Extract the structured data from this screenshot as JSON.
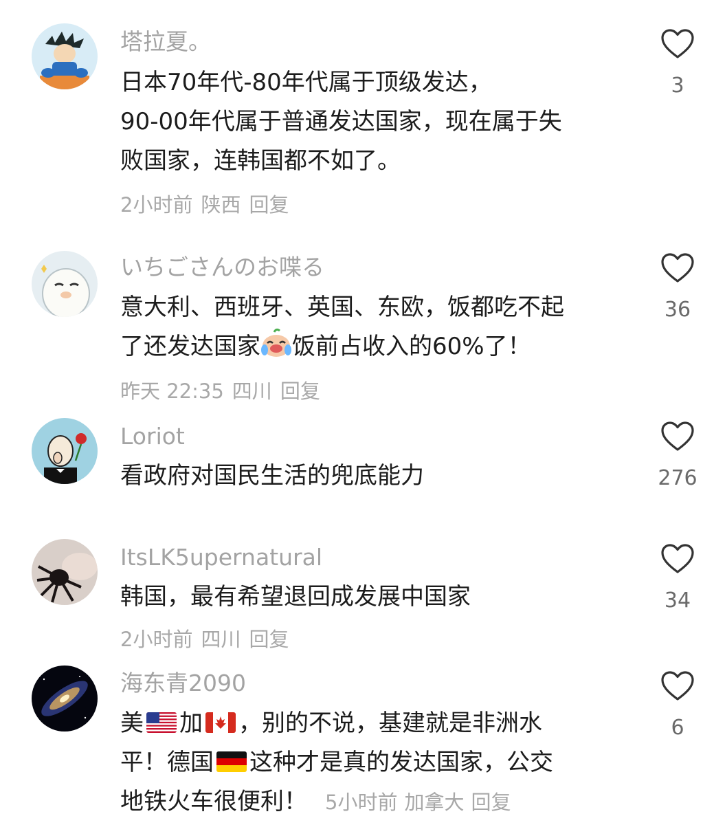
{
  "comments": [
    {
      "username": "塔拉夏。",
      "lines": [
        "日本70年代-80年代属于顶级发达，",
        "90-00年代属于普通发达国家，现在属于失",
        "败国家，连韩国都不如了。"
      ],
      "time": "2小时前",
      "location": "陕西",
      "reply": "回复",
      "likes": "3",
      "avatar_icon": "cartoon-boy-avatar"
    },
    {
      "username": "いちごさんのお喋る",
      "line1": "意大利、西班牙、英国、东欧，饭都吃不起",
      "line2_a": "了还发达国家",
      "emoji": "crying-laughing-emoji",
      "line2_b": "饭前占收入的60%了！",
      "time": "昨天 22:35",
      "location": "四川",
      "reply": "回复",
      "likes": "36",
      "avatar_icon": "cartoon-seal-avatar"
    },
    {
      "username": "Loriot",
      "lines": [
        "看政府对国民生活的兜底能力"
      ],
      "likes": "276",
      "avatar_icon": "cartoon-gentleman-rose-avatar"
    },
    {
      "username": "ItsLK5upernatural",
      "lines": [
        "韩国，最有希望退回成发展中国家"
      ],
      "time": "2小时前",
      "location": "四川",
      "reply": "回复",
      "likes": "34",
      "avatar_icon": "spider-photo-avatar"
    },
    {
      "username": "海东青2090",
      "l1_a": "美",
      "l1_b": "加",
      "l1_c": "，别的不说，基建就是非洲水",
      "l2_a": "平！德国",
      "l2_b": "这种才是真的发达国家，公交",
      "l3": "地铁火车很便利！",
      "time": "5小时前",
      "location": "加拿大",
      "reply": "回复",
      "likes": "6",
      "avatar_icon": "galaxy-avatar",
      "flags": [
        "us-flag-icon",
        "canada-flag-icon",
        "germany-flag-icon"
      ]
    }
  ],
  "colors": {
    "username": "#a3a3a3",
    "body": "#1c1c1c",
    "meta": "#a8a8a8",
    "like_count": "#6a6a6a",
    "like_icon": "#333333"
  },
  "like_icon": "heart-outline-icon"
}
